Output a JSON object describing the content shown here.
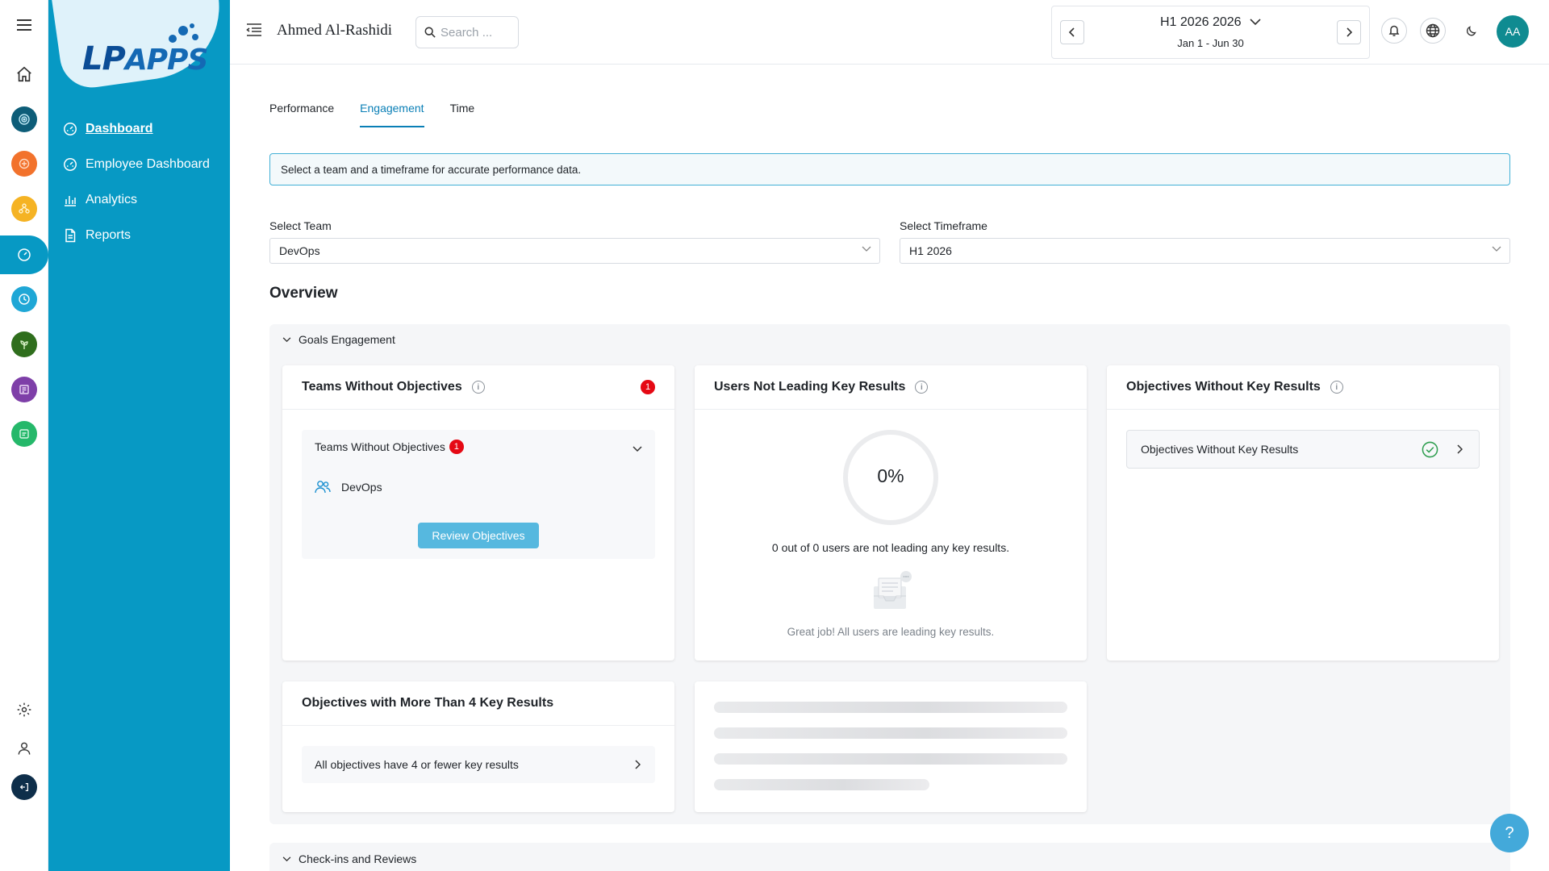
{
  "app": {
    "brand": "APPS",
    "brand_prefix": "LP"
  },
  "sidebar": {
    "items": [
      {
        "label": "Dashboard",
        "icon": "dashboard-gauge-icon"
      },
      {
        "label": "Employee Dashboard",
        "icon": "dashboard-gauge-icon"
      },
      {
        "label": "Analytics",
        "icon": "bar-chart-icon"
      },
      {
        "label": "Reports",
        "icon": "document-icon"
      }
    ]
  },
  "header": {
    "user_name": "Ahmed Al-Rashidi",
    "search_placeholder": "Search ...",
    "period_title": "H1 2026 2026",
    "period_range": "Jan 1 - Jun 30",
    "avatar_initials": "AA"
  },
  "tabs": [
    {
      "label": "Performance"
    },
    {
      "label": "Engagement"
    },
    {
      "label": "Time"
    }
  ],
  "alert_text": "Select a team and a timeframe for accurate performance data.",
  "filters": {
    "team_label": "Select Team",
    "team_value": "DevOps",
    "timeframe_label": "Select Timeframe",
    "timeframe_value": "H1 2026"
  },
  "overview_title": "Overview",
  "goals_section": {
    "title": "Goals Engagement",
    "teams_without_objectives": {
      "title": "Teams Without Objectives",
      "count": "1",
      "group_label": "Teams Without Objectives",
      "group_count": "1",
      "team": "DevOps",
      "button": "Review Objectives"
    },
    "users_not_leading": {
      "title": "Users Not Leading Key Results",
      "percent": "0%",
      "percent_value": 0,
      "summary": "0 out of 0 users are not leading any key results.",
      "empty_message": "Great job! All users are leading key results."
    },
    "objectives_without_krs": {
      "title": "Objectives Without Key Results",
      "row_label": "Objectives Without Key Results"
    },
    "objectives_more_than_4": {
      "title": "Objectives with More Than 4 Key Results",
      "row_label": "All objectives have 4 or fewer key results"
    }
  },
  "checkins_section": {
    "title": "Check-ins and Reviews"
  },
  "colors": {
    "brand": "#0799c4",
    "accent": "#0a7fb6",
    "badge": "#e50914",
    "success": "#2e9e4f"
  }
}
